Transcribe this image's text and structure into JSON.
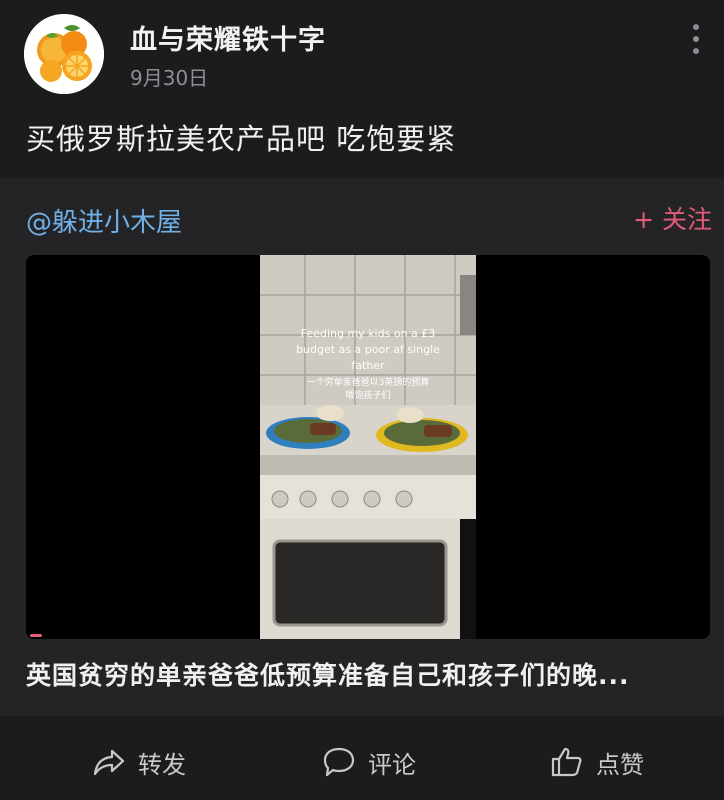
{
  "post": {
    "username": "血与荣耀铁十字",
    "date": "9月30日",
    "text": "买俄罗斯拉美农产品吧 吃饱要紧"
  },
  "repost": {
    "author": "@躲进小木屋",
    "follow_label": "+ 关注",
    "video": {
      "caption_en_1": "Feeding my kids on a £3",
      "caption_en_2": "budget as a poor af single",
      "caption_en_3": "father",
      "caption_cn_1": "一个穷单亲爸爸以3英镑的预算",
      "caption_cn_2": "喂饱孩子们"
    },
    "title": "英国贫穷的单亲爸爸低预算准备自己和孩子们的晚..."
  },
  "actions": {
    "share_label": "转发",
    "comment_label": "评论",
    "like_label": "点赞"
  },
  "icons": {
    "avatar": "orange-fruit-avatar",
    "more": "more-vertical-icon",
    "share": "share-arrow-icon",
    "comment": "comment-bubble-icon",
    "like": "thumbs-up-icon"
  },
  "colors": {
    "background": "#1c1c1e",
    "repost_background": "#242426",
    "author_link": "#6fb0e8",
    "follow": "#e05c7a"
  }
}
